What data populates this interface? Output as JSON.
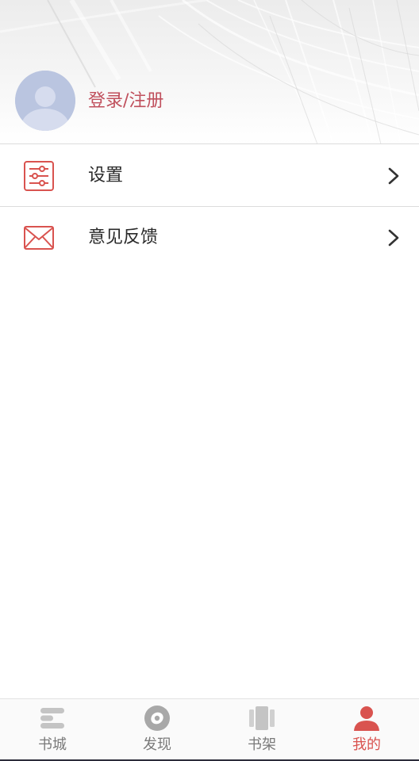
{
  "header": {
    "login_label": "登录/注册"
  },
  "menu": [
    {
      "label": "设置",
      "icon": "settings-sliders-icon"
    },
    {
      "label": "意见反馈",
      "icon": "mail-envelope-icon"
    }
  ],
  "tabbar": [
    {
      "label": "书城",
      "icon": "book-stack-icon",
      "active": false
    },
    {
      "label": "发现",
      "icon": "compass-disc-icon",
      "active": false
    },
    {
      "label": "书架",
      "icon": "bookshelf-icon",
      "active": false
    },
    {
      "label": "我的",
      "icon": "person-icon",
      "active": true
    }
  ],
  "colors": {
    "accent": "#d9534f",
    "login_text": "#c0505d",
    "avatar_bg": "#bac5e0",
    "tab_inactive": "#7a7a7a"
  }
}
